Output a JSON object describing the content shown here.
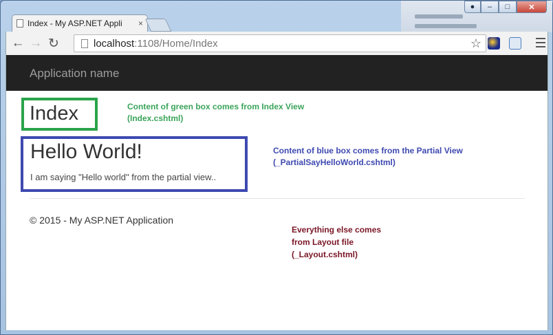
{
  "browser": {
    "tab_title": "Index - My ASP.NET Appli",
    "tab_close": "×",
    "url_host": "localhost",
    "url_path": ":1108/Home/Index",
    "back_glyph": "←",
    "forward_glyph": "→",
    "reload_glyph": "↻",
    "star_glyph": "☆"
  },
  "page": {
    "brand": "Application name",
    "index_title": "Index",
    "hello_title": "Hello World!",
    "hello_text": "I am saying \"Hello world\" from the partial view..",
    "footer": "© 2015 - My ASP.NET Application"
  },
  "annotations": {
    "green_lines": [
      "Content of green box comes from Index View",
      "(Index.cshtml)"
    ],
    "blue_lines": [
      "Content of blue box comes from the Partial View",
      "(_PartialSayHelloWorld.cshtml)"
    ],
    "red_lines": [
      "Everything else comes",
      "from Layout file",
      "(_Layout.cshtml)"
    ]
  },
  "colors": {
    "navbar": "#222222",
    "green_box": "#2aa44a",
    "blue_box": "#3e49b0",
    "red_note": "#7a1626"
  }
}
